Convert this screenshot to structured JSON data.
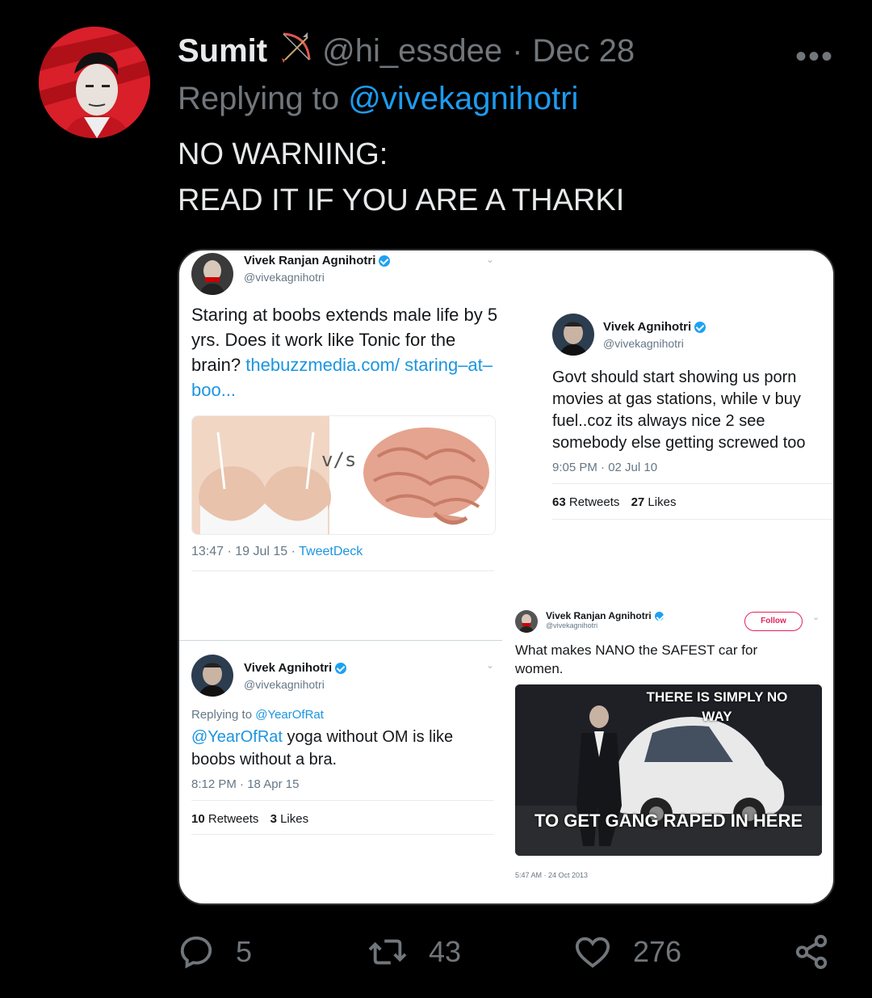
{
  "tweet": {
    "display_name": "Sumit",
    "emoji_icon": "bow-and-arrow-icon",
    "handle": "@hi_essdee",
    "separator": "·",
    "date": "Dec 28",
    "more_label": "•••",
    "replying_prefix": "Replying to",
    "replying_to": "@vivekagnihotri",
    "body_line1": "NO WARNING:",
    "body_line2": "READ IT IF YOU ARE A THARKI",
    "reply_count": "5",
    "retweet_count": "43",
    "like_count": "276"
  },
  "media": {
    "card1": {
      "name": "Vivek Ranjan Agnihotri",
      "handle": "@vivekagnihotri",
      "text": "Staring at boobs extends male life by 5 yrs. Does it work like Tonic for the brain?",
      "link": "thebuzzmedia.com/ staring–at–boo...",
      "vs": "v/s",
      "meta_time": "13:47 · 19 Jul 15 ·",
      "meta_source": "TweetDeck"
    },
    "card2": {
      "name": "Vivek Agnihotri",
      "handle": "@vivekagnihotri",
      "text": "Govt should start showing us porn movies at gas stations, while v buy fuel..coz its always nice 2 see somebody else getting screwed too",
      "meta": "9:05 PM · 02 Jul 10",
      "retweets": "63",
      "retweets_label": "Retweets",
      "likes": "27",
      "likes_label": "Likes"
    },
    "card3": {
      "name": "Vivek Agnihotri",
      "handle": "@vivekagnihotri",
      "replying_prefix": "Replying to",
      "replying_to": "@YearOfRat",
      "mention": "@YearOfRat",
      "text": "yoga without OM is like boobs without a bra.",
      "meta": "8:12 PM · 18 Apr 15",
      "retweets": "10",
      "retweets_label": "Retweets",
      "likes": "3",
      "likes_label": "Likes"
    },
    "card4": {
      "name": "Vivek Ranjan Agnihotri",
      "handle": "@vivekagnihotri",
      "follow_label": "Follow",
      "text": "What makes NANO the SAFEST car for women.",
      "meme_top": "THERE IS SIMPLY NO WAY",
      "meme_bottom": "TO GET GANG RAPED IN HERE",
      "meta": "5:47 AM · 24 Oct 2013"
    }
  }
}
